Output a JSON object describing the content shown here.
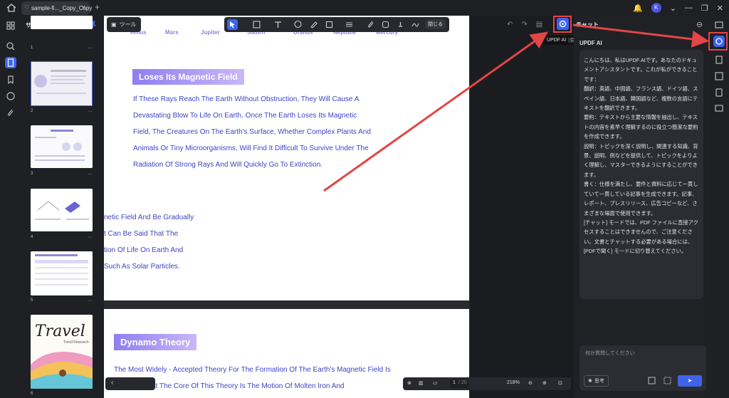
{
  "titlebar": {
    "tab_title": "sample-fi..._Copy_Copy",
    "avatar_letter": "K"
  },
  "thumbnail_panel": {
    "title": "サムネール",
    "pages": [
      {
        "num": "1",
        "dots": "···"
      },
      {
        "num": "2",
        "dots": "···"
      },
      {
        "num": "3",
        "dots": "···"
      },
      {
        "num": "4",
        "dots": "···"
      },
      {
        "num": "5",
        "dots": "···"
      },
      {
        "num": "6",
        "dots": "···"
      }
    ],
    "travel_title": "Travel",
    "travel_sub": "Trend Research"
  },
  "toolbar": {
    "tool_label": "ツール",
    "close_label": "閉じる"
  },
  "document": {
    "planets": [
      "Venus",
      "Mars",
      "Jupiter",
      "Saturn",
      "Uranus",
      "Neptune",
      "Mercury"
    ],
    "heading1": "Loses Its Magnetic Field",
    "para1": [
      "If These Rays Reach The Earth Without Obstruction, They Will Cause A",
      "Devastating Blow To Life On Earth. Once The Earth Loses Its Magnetic",
      "Field, The Creatures On The Earth's Surface, Whether Complex Plants And",
      "Animals Or Tiny Microorganisms, Will Find It Difficult To Survive Under The",
      "Radiation Of Strong Rays And Will Quickly Go To Extinction."
    ],
    "para2": [
      "netic Field And Be Gradually",
      "t Can Be Said That The",
      "tion Of Life On Earth And",
      "Such As Solar Particles."
    ],
    "heading2": "Dynamo Theory",
    "para3": [
      "The Most Widely - Accepted Theory For The Formation Of The Earth's Magnetic Field Is",
      "mo Theory. At The Core Of This Theory Is The Motion Of Molten Iron And"
    ]
  },
  "ai_button": {
    "tooltip_label": "UPDF AI",
    "tooltip_shortcut": "Ctrl+K"
  },
  "bottom": {
    "page_current": "1",
    "page_total": "/ 20",
    "zoom": "218%"
  },
  "chat": {
    "title": "チャット",
    "ai_name": "UPDF AI",
    "message": [
      "こんにちは、私はUPDF AIです。あなたのドキュメントアシスタントです。これが私ができることです：",
      "翻訳：英語、中国語、フランス語、ドイツ語、スペイン語、日本語、韓国語など、複数の言語にテキストを翻訳できます。",
      "要約：テキストから主要な情報を抽出し、テキストの内容を素早く理解するのに役立つ簡潔な要約を作成できます。",
      "説明：トピックを深く説明し、関連する知識、背景、説明、例などを提供して、トピックをよりよく理解し、マスターできるようにすることができます。",
      "書く：仕様を満たし、要件と資料に応じて一貫していて一貫している記事を生成できます。記事、レポート、プレスリリース、広告コピーなど、さまざまな場面で使用できます。",
      "[チャット] モードでは、PDF ファイルに直接アクセスすることはできませんので、ご注意ください。文書とチャットする必要がある場合には、[PDFで聞く] モードに切り替えてください。"
    ],
    "input_placeholder": "何か質問してください",
    "think_label": "思考"
  },
  "annotation": {
    "arrow_color": "#e24646"
  }
}
